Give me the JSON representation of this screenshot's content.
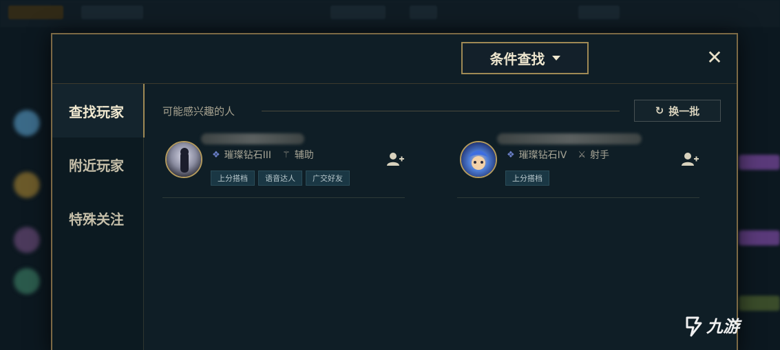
{
  "header": {
    "filter_button": "条件查找",
    "close_symbol": "✕"
  },
  "sidebar": {
    "tabs": [
      {
        "label": "查找玩家",
        "active": true
      },
      {
        "label": "附近玩家",
        "active": false
      },
      {
        "label": "特殊关注",
        "active": false
      }
    ]
  },
  "content": {
    "section_title": "可能感兴趣的人",
    "refresh_label": "换一批",
    "players": [
      {
        "rank": "璀璨钻石III",
        "role": "辅助",
        "tags": [
          "上分搭档",
          "语音达人",
          "广交好友"
        ]
      },
      {
        "rank": "璀璨钻石IV",
        "role": "射手",
        "tags": [
          "上分搭档"
        ]
      }
    ]
  },
  "watermark": {
    "text": "九游"
  },
  "colors": {
    "gold_border": "#7d6a45",
    "panel_bg": "#0f1e26",
    "tag_bg": "#1a3744",
    "rank_icon": "#6a7fc8"
  },
  "icons": {
    "close": "close-icon",
    "caret": "caret-down-icon",
    "refresh": "refresh-icon",
    "add_friend": "add-friend-icon",
    "rank": "rank-badge-icon",
    "support_role": "support-role-icon",
    "marksman_role": "marksman-role-icon"
  }
}
